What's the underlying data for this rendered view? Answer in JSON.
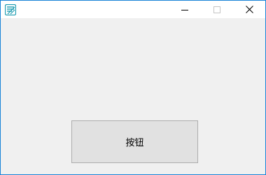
{
  "window": {
    "icon": "app-icon",
    "controls": {
      "minimize_icon": "minimize-icon",
      "maximize_icon": "maximize-icon",
      "close_icon": "close-icon"
    }
  },
  "main": {
    "button_label": "按钮"
  },
  "colors": {
    "window_border": "#1883d7",
    "titlebar_bg": "#ffffff",
    "client_bg": "#f0f0f0",
    "button_bg": "#e1e1e1",
    "button_border": "#adadad",
    "icon_teal": "#1a9bb0"
  }
}
